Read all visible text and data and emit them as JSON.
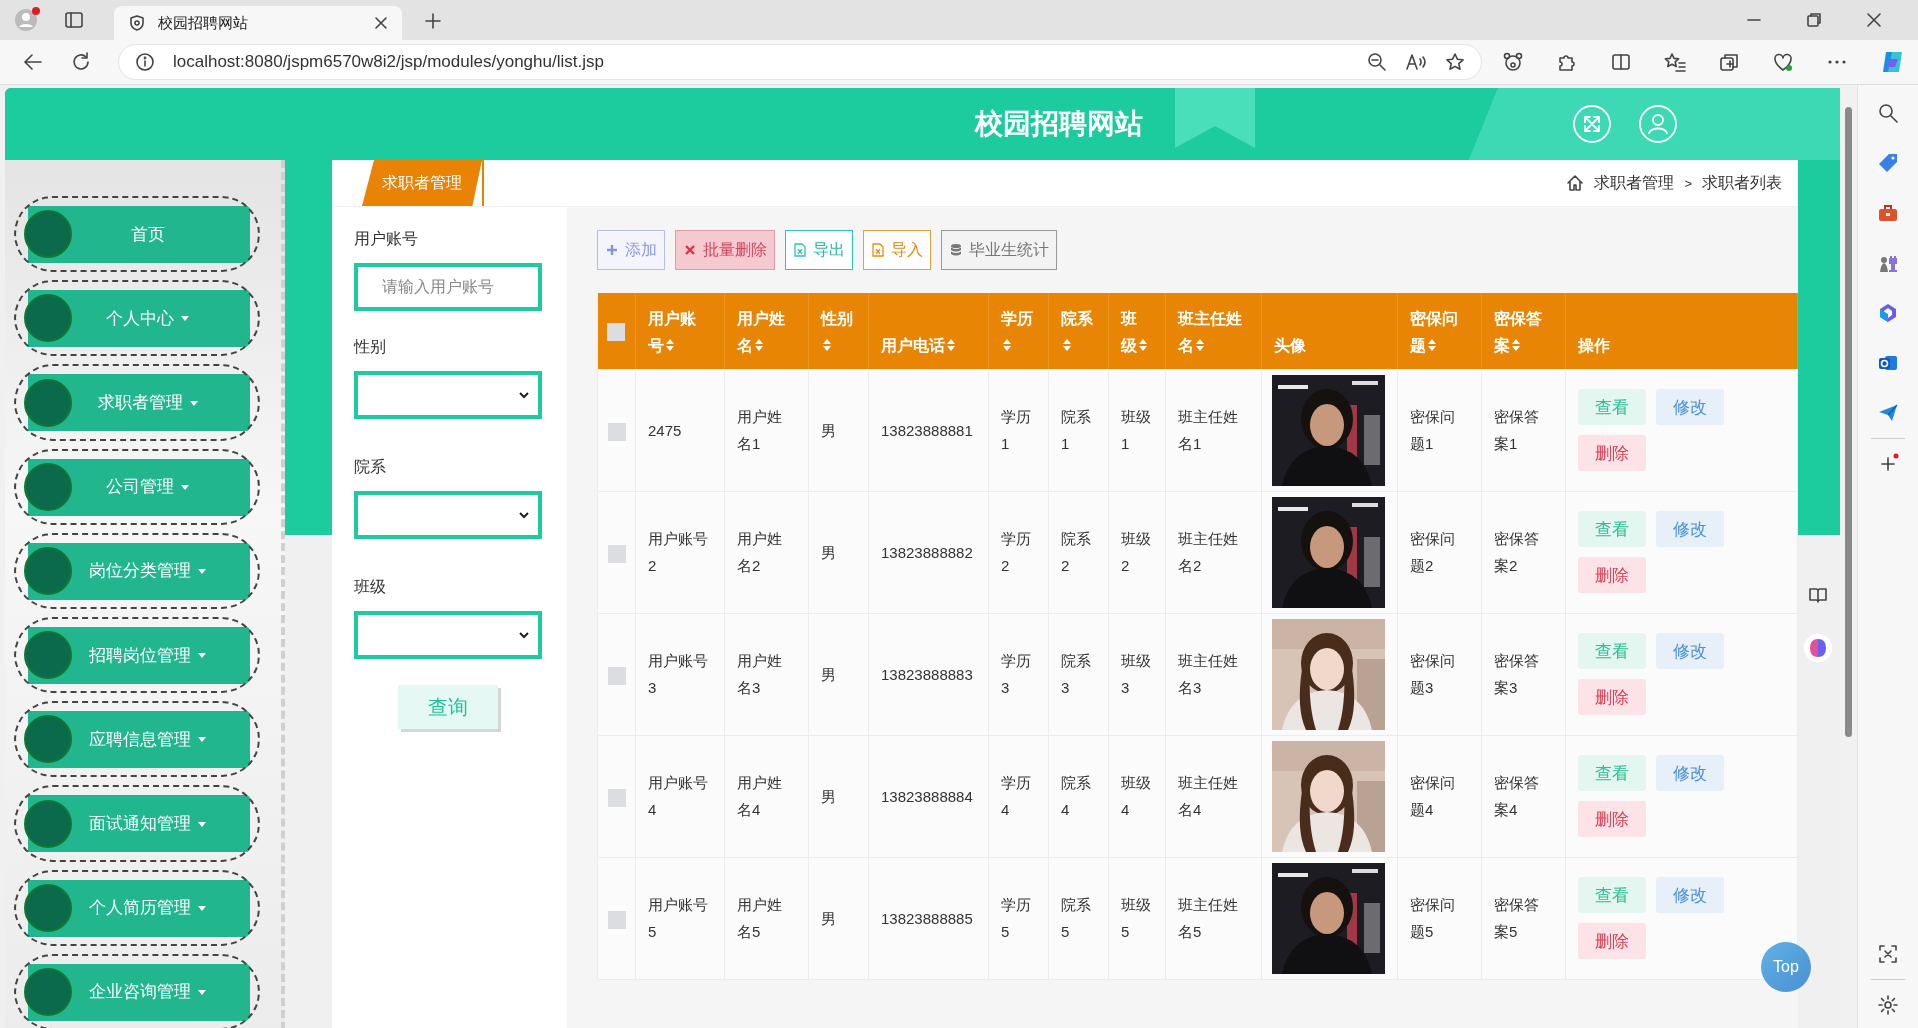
{
  "browser": {
    "tab_title": "校园招聘网站",
    "url": "localhost:8080/jspm6570w8i2/jsp/modules/yonghu/list.jsp"
  },
  "site": {
    "title": "校园招聘网站"
  },
  "sidebar": {
    "items": [
      {
        "label": "首页",
        "has_menu": false
      },
      {
        "label": "个人中心",
        "has_menu": true
      },
      {
        "label": "求职者管理",
        "has_menu": true
      },
      {
        "label": "公司管理",
        "has_menu": true
      },
      {
        "label": "岗位分类管理",
        "has_menu": true
      },
      {
        "label": "招聘岗位管理",
        "has_menu": true
      },
      {
        "label": "应聘信息管理",
        "has_menu": true
      },
      {
        "label": "面试通知管理",
        "has_menu": true
      },
      {
        "label": "个人简历管理",
        "has_menu": true
      },
      {
        "label": "企业咨询管理",
        "has_menu": true
      }
    ]
  },
  "tabs": [
    {
      "label": "求职者管理",
      "selected": true
    }
  ],
  "breadcrumb": [
    "求职者管理",
    ">",
    "求职者列表"
  ],
  "filters": [
    {
      "label": "用户账号",
      "kind": "text",
      "placeholder": "请输入用户账号"
    },
    {
      "label": "性别",
      "kind": "select"
    },
    {
      "label": "院系",
      "kind": "select"
    },
    {
      "label": "班级",
      "kind": "select"
    }
  ],
  "search_button": "查询",
  "toolbar": [
    {
      "kind": "add",
      "label": "添加"
    },
    {
      "kind": "delete",
      "label": "批量删除"
    },
    {
      "kind": "export",
      "label": "导出"
    },
    {
      "kind": "import",
      "label": "导入"
    },
    {
      "kind": "stats",
      "label": "毕业生统计"
    }
  ],
  "table": {
    "select_all": {
      "checked": false
    },
    "columns": [
      {
        "label": "用户账号",
        "sortable": true
      },
      {
        "label": "用户姓名",
        "sortable": true
      },
      {
        "label": "性别",
        "sortable": true
      },
      {
        "label": "用户电话",
        "sortable": true
      },
      {
        "label": "学历",
        "sortable": true
      },
      {
        "label": "院系",
        "sortable": true
      },
      {
        "label": "班级",
        "sortable": true
      },
      {
        "label": "班主任姓名",
        "sortable": true
      },
      {
        "label": "头像",
        "sortable": false
      },
      {
        "label": "密保问题",
        "sortable": true
      },
      {
        "label": "密保答案",
        "sortable": true
      },
      {
        "label": "操作",
        "sortable": false
      }
    ],
    "rows": [
      {
        "checked": false,
        "cells": [
          "2475",
          "用户姓名1",
          "男",
          "13823888881",
          "学历1",
          "院系1",
          "班级1",
          "班主任姓名1",
          {
            "kind": "picture"
          },
          "密保问题1",
          "密保答案1"
        ],
        "actions": [
          {
            "kind": "view",
            "label": "查看"
          },
          {
            "kind": "edit",
            "label": "修改"
          },
          {
            "kind": "delete",
            "label": "删除"
          }
        ]
      },
      {
        "checked": false,
        "cells": [
          "用户账号2",
          "用户姓名2",
          "男",
          "13823888882",
          "学历2",
          "院系2",
          "班级2",
          "班主任姓名2",
          {
            "kind": "picture"
          },
          "密保问题2",
          "密保答案2"
        ],
        "actions": [
          {
            "kind": "view",
            "label": "查看"
          },
          {
            "kind": "edit",
            "label": "修改"
          },
          {
            "kind": "delete",
            "label": "删除"
          }
        ]
      },
      {
        "checked": false,
        "cells": [
          "用户账号3",
          "用户姓名3",
          "男",
          "13823888883",
          "学历3",
          "院系3",
          "班级3",
          "班主任姓名3",
          {
            "kind": "picture"
          },
          "密保问题3",
          "密保答案3"
        ],
        "actions": [
          {
            "kind": "view",
            "label": "查看"
          },
          {
            "kind": "edit",
            "label": "修改"
          },
          {
            "kind": "delete",
            "label": "删除"
          }
        ]
      },
      {
        "checked": false,
        "cells": [
          "用户账号4",
          "用户姓名4",
          "男",
          "13823888884",
          "学历4",
          "院系4",
          "班级4",
          "班主任姓名4",
          {
            "kind": "picture"
          },
          "密保问题4",
          "密保答案4"
        ],
        "actions": [
          {
            "kind": "view",
            "label": "查看"
          },
          {
            "kind": "edit",
            "label": "修改"
          },
          {
            "kind": "delete",
            "label": "删除"
          }
        ]
      },
      {
        "checked": false,
        "cells": [
          "用户账号5",
          "用户姓名5",
          "男",
          "13823888885",
          "学历5",
          "院系5",
          "班级5",
          "班主任姓名5",
          {
            "kind": "picture"
          },
          "密保问题5",
          "密保答案5"
        ],
        "actions": [
          {
            "kind": "view",
            "label": "查看"
          },
          {
            "kind": "edit",
            "label": "修改"
          },
          {
            "kind": "delete",
            "label": "删除"
          }
        ]
      }
    ]
  },
  "top_button": "Top"
}
